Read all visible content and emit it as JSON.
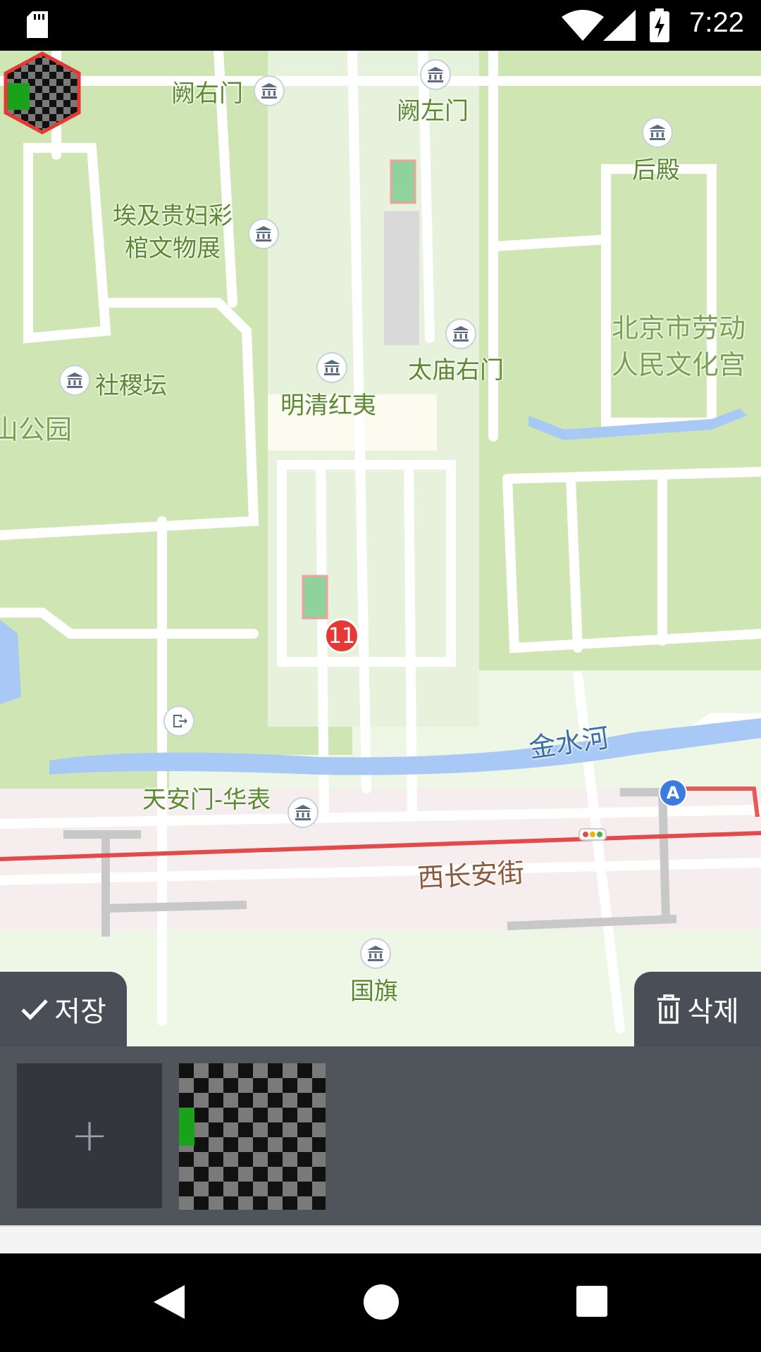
{
  "status_bar": {
    "time": "7:22",
    "icons": [
      "sd-card-icon",
      "wifi-icon",
      "signal-icon",
      "battery-charging-icon"
    ]
  },
  "map": {
    "labels": [
      {
        "id": "queyoumen",
        "text": "阙右门"
      },
      {
        "id": "quezuomen",
        "text": "阙左门"
      },
      {
        "id": "houdian",
        "text": "后殿"
      },
      {
        "id": "egypt",
        "text": "埃及贵妇彩\n棺文物展"
      },
      {
        "id": "laodong",
        "text": "北京市劳动\n人民文化宫"
      },
      {
        "id": "taimiao",
        "text": "太庙右门"
      },
      {
        "id": "shejitan",
        "text": "社稷坛"
      },
      {
        "id": "mingqing",
        "text": "明清红夷"
      },
      {
        "id": "park",
        "text": "山公园"
      },
      {
        "id": "jinshuihe",
        "text": "金水河"
      },
      {
        "id": "tiananmen",
        "text": "天安门-华表"
      },
      {
        "id": "xichanganjie",
        "text": "西长安街"
      },
      {
        "id": "guoqi",
        "text": "国旗"
      }
    ],
    "subway_badge": "A",
    "marker": {
      "badge_count": "11"
    },
    "colors": {
      "road": "#ffffff",
      "park": "#cfe5b3",
      "water": "#a8c8f5",
      "subway": "#e34b4b"
    }
  },
  "editor": {
    "save_label": "저장",
    "delete_label": "삭제",
    "add_label": "+"
  }
}
